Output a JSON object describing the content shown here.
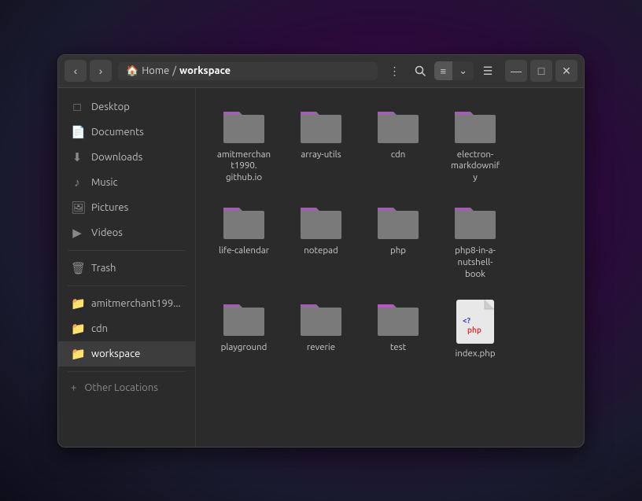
{
  "titlebar": {
    "back_label": "‹",
    "forward_label": "›",
    "breadcrumb_home": "Home",
    "breadcrumb_sep": "/",
    "breadcrumb_current": "workspace",
    "menu_icon": "⋮",
    "search_icon": "🔍",
    "list_view_icon": "≡",
    "chevron_icon": "⌄",
    "panel_icon": "☰",
    "minimize_icon": "—",
    "maximize_icon": "□",
    "close_icon": "✕"
  },
  "sidebar": {
    "items": [
      {
        "id": "desktop",
        "label": "Desktop",
        "icon": "🖥"
      },
      {
        "id": "documents",
        "label": "Documents",
        "icon": "📄"
      },
      {
        "id": "downloads",
        "label": "Downloads",
        "icon": "⬇"
      },
      {
        "id": "music",
        "label": "Music",
        "icon": "🎵"
      },
      {
        "id": "pictures",
        "label": "Pictures",
        "icon": "🖼"
      },
      {
        "id": "videos",
        "label": "Videos",
        "icon": "📹"
      },
      {
        "id": "trash",
        "label": "Trash",
        "icon": "🗑"
      },
      {
        "id": "amitmerchant",
        "label": "amitmerchant199...",
        "icon": "📁"
      },
      {
        "id": "cdn",
        "label": "cdn",
        "icon": "📁"
      },
      {
        "id": "workspace",
        "label": "workspace",
        "icon": "📁"
      }
    ],
    "add_label": "Other Locations",
    "add_icon": "+"
  },
  "files": [
    {
      "id": "amitmerchant",
      "type": "folder",
      "name": "amitmerchan\nt1990.\ngithub.io"
    },
    {
      "id": "array-utils",
      "type": "folder",
      "name": "array-utils"
    },
    {
      "id": "cdn",
      "type": "folder",
      "name": "cdn"
    },
    {
      "id": "electron-markdownify",
      "type": "folder",
      "name": "electron-\nmarkdownif\ny"
    },
    {
      "id": "life-calendar",
      "type": "folder",
      "name": "life-calendar"
    },
    {
      "id": "notepad",
      "type": "folder",
      "name": "notepad"
    },
    {
      "id": "php",
      "type": "folder",
      "name": "php"
    },
    {
      "id": "php8-in-a-nutshell-book",
      "type": "folder",
      "name": "php8-in-a-\nnutshell-\nbook"
    },
    {
      "id": "playground",
      "type": "folder",
      "name": "playground"
    },
    {
      "id": "reverie",
      "type": "folder",
      "name": "reverie"
    },
    {
      "id": "test",
      "type": "folder-pink",
      "name": "test"
    },
    {
      "id": "index.php",
      "type": "php-file",
      "name": "index.php"
    }
  ]
}
